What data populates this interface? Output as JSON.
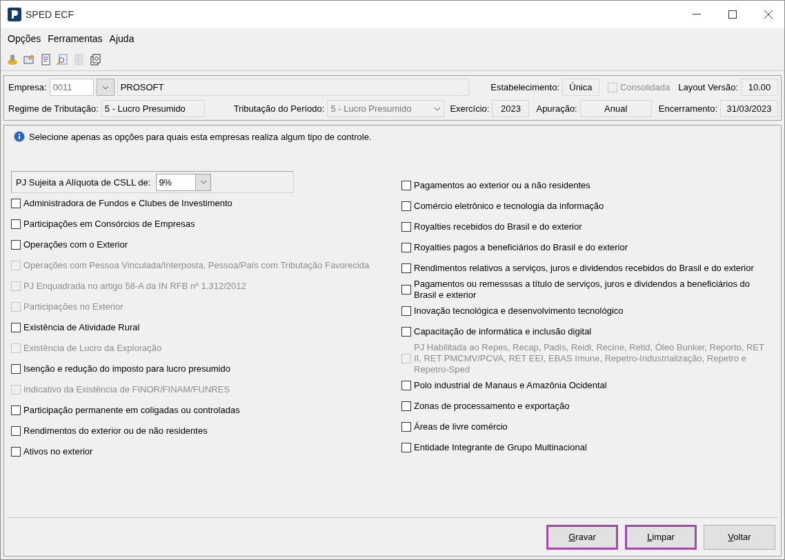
{
  "window": {
    "title": "SPED ECF"
  },
  "menu": [
    "Opções",
    "Ferramentas",
    "Ajuda"
  ],
  "toolbar": [
    {
      "kind": "coin",
      "disabled": false
    },
    {
      "kind": "form",
      "disabled": false
    },
    {
      "kind": "document",
      "disabled": false
    },
    {
      "kind": "preview",
      "disabled": false
    },
    {
      "kind": "sheet",
      "disabled": true
    },
    {
      "kind": "copies",
      "disabled": false
    }
  ],
  "header": {
    "empresa_label": "Empresa:",
    "empresa_code": "0011",
    "empresa_name": "PROSOFT",
    "estabelecimento_label": "Estabelecimento:",
    "estabelecimento": "Única",
    "consolidada": {
      "label": "Consolidada",
      "checked": false,
      "disabled": true
    },
    "layout_label": "Layout Versão:",
    "layout": "10.00",
    "regime_label": "Regime de Tributação:",
    "regime": "5 - Lucro Presumido",
    "periodo_label": "Tributação do Período:",
    "periodo": "5 - Lucro Presumido",
    "exercicio_label": "Exercício:",
    "exercicio": "2023",
    "apuracao_label": "Apuração:",
    "apuracao": "Anual",
    "encerramento_label": "Encerramento:",
    "encerramento": "31/03/2023"
  },
  "info": "Selecione apenas as opções para quais esta  empresas realiza algum tipo de controle.",
  "csll": {
    "label": "PJ Sujeita a Alíquota de CSLL de:",
    "value": "9%"
  },
  "left_options": [
    {
      "label": "Administradora de Fundos e Clubes de Investimento",
      "checked": false,
      "disabled": false
    },
    {
      "label": "Participações em Consórcios de Empresas",
      "checked": false,
      "disabled": false
    },
    {
      "label": "Operações com o Exterior",
      "checked": false,
      "disabled": false
    },
    {
      "label": "Operações com Pessoa Vinculada/Interposta, Pessoa/País com Tributação Favorecida",
      "checked": false,
      "disabled": true
    },
    {
      "label": "PJ Enquadrada no artigo 58-A da IN RFB nº 1.312/2012",
      "checked": false,
      "disabled": true
    },
    {
      "label": "Participações no Exterior",
      "checked": false,
      "disabled": true
    },
    {
      "label": "Existência de Atividade Rural",
      "checked": false,
      "disabled": false
    },
    {
      "label": "Existência de Lucro da Exploração",
      "checked": false,
      "disabled": true
    },
    {
      "label": "Isenção e redução do imposto para lucro presumido",
      "checked": false,
      "disabled": false
    },
    {
      "label": "Indicativo da Existência de FINOR/FINAM/FUNRES",
      "checked": false,
      "disabled": true
    },
    {
      "label": "Participação permanente em coligadas ou controladas",
      "checked": false,
      "disabled": false
    },
    {
      "label": "Rendimentos do exterior ou de não residentes",
      "checked": false,
      "disabled": false
    },
    {
      "label": "Ativos no exterior",
      "checked": false,
      "disabled": false
    }
  ],
  "right_options": [
    {
      "label": "Pagamentos ao exterior ou a não residentes",
      "checked": false,
      "disabled": false
    },
    {
      "label": "Comércio eletrônico e tecnologia da informação",
      "checked": false,
      "disabled": false
    },
    {
      "label": "Royalties recebidos do Brasil e do exterior",
      "checked": false,
      "disabled": false
    },
    {
      "label": "Royalties pagos a beneficiários do Brasil e do exterior",
      "checked": false,
      "disabled": false
    },
    {
      "label": "Rendimentos relativos a serviços, juros e dividendos recebidos do Brasil e do exterior",
      "checked": false,
      "disabled": false
    },
    {
      "label": "Pagamentos ou remesssas a título de serviços, juros e dividendos a beneficiários do Brasil e exterior",
      "checked": false,
      "disabled": false
    },
    {
      "label": "Inovação tecnológica e desenvolvimento tecnológico",
      "checked": false,
      "disabled": false
    },
    {
      "label": "Capacitação de informática e inclusão digital",
      "checked": false,
      "disabled": false
    },
    {
      "label": "PJ Habilitada ao Repes, Recap, Padis, Reidi, Recine, Retid, Óleo Bunker, Reporto, RET II, RET PMCMV/PCVA, RET EEI, EBAS Imune, Repetro-Industrialização, Repetro e Repetro-Sped",
      "checked": false,
      "disabled": true
    },
    {
      "label": "Polo industrial de Manaus e Amazônia Ocidental",
      "checked": false,
      "disabled": false
    },
    {
      "label": "Zonas de processamento e exportação",
      "checked": false,
      "disabled": false
    },
    {
      "label": "Áreas de livre comércio",
      "checked": false,
      "disabled": false
    },
    {
      "label": "Entidade Integrante de Grupo Multinacional",
      "checked": false,
      "disabled": false
    }
  ],
  "buttons": [
    {
      "label": "Gravar",
      "highlighted": true
    },
    {
      "label": "Limpar",
      "highlighted": true
    },
    {
      "label": "Voltar",
      "highlighted": false
    }
  ]
}
